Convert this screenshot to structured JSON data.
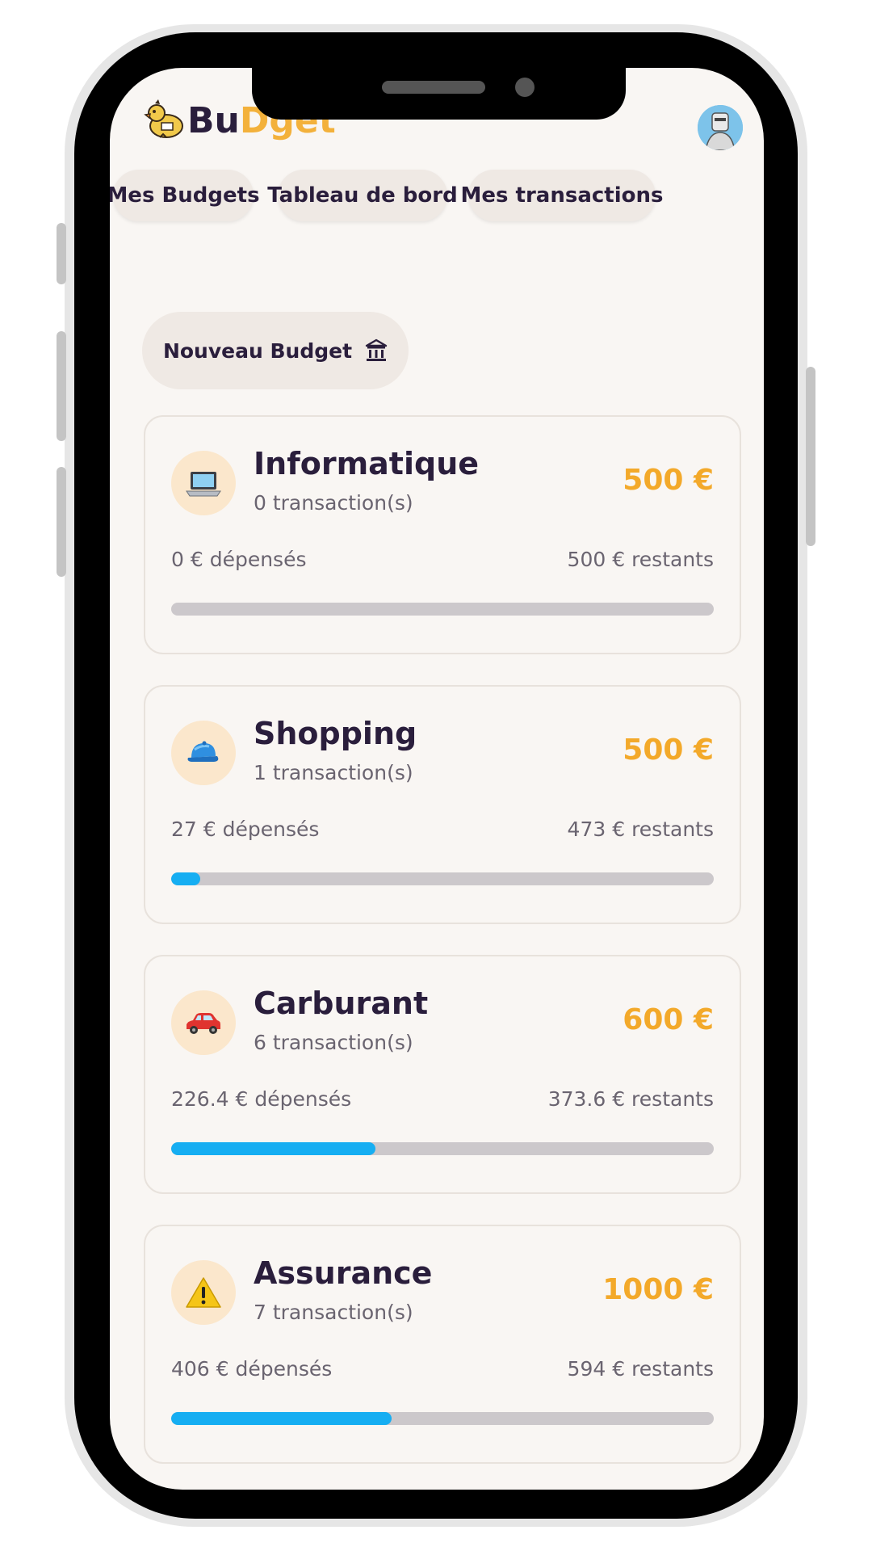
{
  "app": {
    "logo_part1": "Bu",
    "logo_part2": "Dget",
    "brand_color": "#f3b13b",
    "accent_color": "#16aef2"
  },
  "nav": {
    "items": [
      {
        "label": "Mes Budgets"
      },
      {
        "label": "Tableau de bord"
      },
      {
        "label": "Mes transactions"
      }
    ]
  },
  "actions": {
    "new_budget_label": "Nouveau Budget",
    "new_budget_icon": "bank-icon"
  },
  "budgets": [
    {
      "icon": "laptop-icon",
      "title": "Informatique",
      "transactions": "0 transaction(s)",
      "amount": "500 €",
      "spent": "0 € dépensés",
      "remaining": "500 € restants",
      "progress": 0
    },
    {
      "icon": "cap-icon",
      "title": "Shopping",
      "transactions": "1 transaction(s)",
      "amount": "500 €",
      "spent": "27 € dépensés",
      "remaining": "473 € restants",
      "progress": 0.054
    },
    {
      "icon": "car-icon",
      "title": "Carburant",
      "transactions": "6 transaction(s)",
      "amount": "600 €",
      "spent": "226.4 € dépensés",
      "remaining": "373.6 € restants",
      "progress": 0.377
    },
    {
      "icon": "warning-icon",
      "title": "Assurance",
      "transactions": "7 transaction(s)",
      "amount": "1000 €",
      "spent": "406 € dépensés",
      "remaining": "594 € restants",
      "progress": 0.406
    }
  ]
}
